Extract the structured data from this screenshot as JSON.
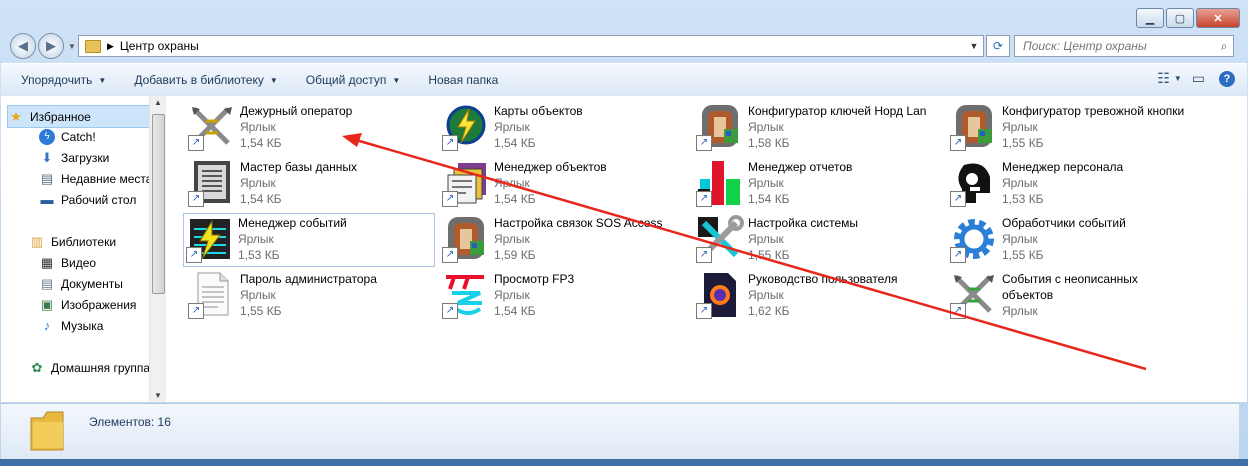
{
  "window": {
    "caption_buttons": [
      "minimize",
      "maximize",
      "close"
    ]
  },
  "address": {
    "path": "Центр охраны"
  },
  "search": {
    "placeholder": "Поиск: Центр охраны"
  },
  "toolbar": {
    "organize": "Упорядочить",
    "add_library": "Добавить в библиотеку",
    "share": "Общий доступ",
    "new_folder": "Новая папка"
  },
  "nav": {
    "favorites": "Избранное",
    "catch": "Catch!",
    "downloads": "Загрузки",
    "recent": "Недавние места",
    "desktop": "Рабочий стол",
    "libraries": "Библиотеки",
    "video": "Видео",
    "documents": "Документы",
    "images": "Изображения",
    "music": "Музыка",
    "homegroup": "Домашняя группа"
  },
  "files": [
    {
      "name": "Дежурный оператор",
      "type": "Ярлык",
      "size": "1,54 КБ",
      "icon": "swords-icon"
    },
    {
      "name": "Карты объектов",
      "type": "Ярлык",
      "size": "1,54 КБ",
      "icon": "globe-bolt-icon"
    },
    {
      "name": "Конфигуратор ключей Норд Lan",
      "type": "Ярлык",
      "size": "1,58 КБ",
      "icon": "archive-icon"
    },
    {
      "name": "Конфигуратор тревожной кнопки",
      "type": "Ярлык",
      "size": "1,55 КБ",
      "icon": "archive-icon"
    },
    {
      "name": "Мастер базы данных",
      "type": "Ярлык",
      "size": "1,54 КБ",
      "icon": "document-icon"
    },
    {
      "name": "Менеджер объектов",
      "type": "Ярлык",
      "size": "1,54 КБ",
      "icon": "cards-icon"
    },
    {
      "name": "Менеджер отчетов",
      "type": "Ярлык",
      "size": "1,54 КБ",
      "icon": "bar-chart-icon"
    },
    {
      "name": "Менеджер персонала",
      "type": "Ярлык",
      "size": "1,53 КБ",
      "icon": "person-icon"
    },
    {
      "name": "Менеджер событий",
      "type": "Ярлык",
      "size": "1,53 КБ",
      "icon": "events-icon"
    },
    {
      "name": "Настройка связок SOS Access",
      "type": "Ярлык",
      "size": "1,59 КБ",
      "icon": "archive-icon"
    },
    {
      "name": "Настройка системы",
      "type": "Ярлык",
      "size": "1,55 КБ",
      "icon": "wrench-icon"
    },
    {
      "name": "Обработчики событий",
      "type": "Ярлык",
      "size": "1,55 КБ",
      "icon": "gear-icon"
    },
    {
      "name": "Пароль администратора",
      "type": "Ярлык",
      "size": "1,55 КБ",
      "icon": "text-file-icon"
    },
    {
      "name": "Просмотр FP3",
      "type": "Ярлык",
      "size": "1,54 КБ",
      "icon": "fp3-icon"
    },
    {
      "name": "Руководство пользователя",
      "type": "Ярлык",
      "size": "1,62 КБ",
      "icon": "pdf-icon"
    },
    {
      "name": "События с неописанных",
      "name2": "объектов",
      "type": "Ярлык",
      "icon": "swords-icon"
    }
  ],
  "status": {
    "count": "Элементов: 16"
  },
  "colors": {
    "arrow": "#e8261c",
    "selection": "#cde5fb",
    "toolbar_text": "#1e395b"
  }
}
